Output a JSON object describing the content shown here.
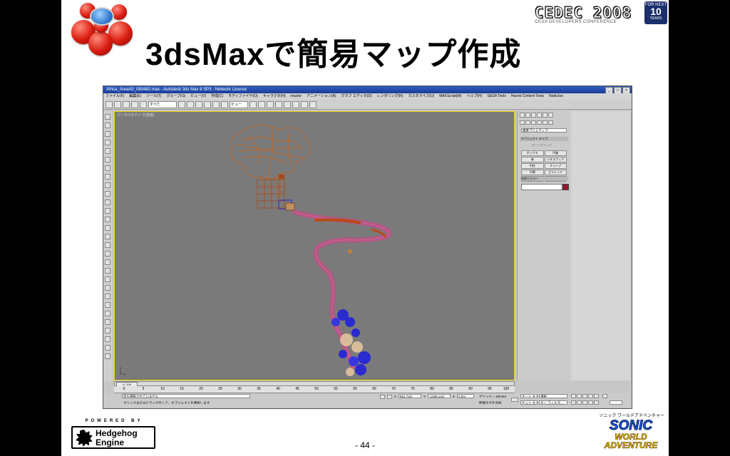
{
  "slide": {
    "title": "3dsMaxで簡易マップ作成",
    "page_number": "- 44 -"
  },
  "cedec": {
    "logo_text": "CEDEC 2008",
    "sub_text": "CESA DEVELOPERS CONFERENCE",
    "years_top": "FOR NEXT",
    "years_num": "10",
    "years_bottom": "YEARS"
  },
  "max_window": {
    "title": "Africa_AreaA0_080482.max - Autodesk 3ds Max 8 SP3 - Network License",
    "menu": [
      "ファイル(F)",
      "編集(E)",
      "ツール(T)",
      "グループ(G)",
      "ビュー(V)",
      "作成(C)",
      "モディファイヤ(O)",
      "キャラクタ(H)",
      "reactor",
      "アニメーション(A)",
      "グラフ エディタ(D)",
      "レンダリング(R)",
      "カスタマイズ(U)",
      "MAXScript(M)",
      "ヘルプ(H)",
      "SEGA Tools",
      "Havok Content Tools",
      "NodeJoe"
    ],
    "toolbar_selection": "すべて",
    "toolbar_view": "ビュー",
    "viewport_label": "パースペクティブ(透視)",
    "command_panel": {
      "category": "標準プリミティブ",
      "object_type_header": "オブジェクト タイプ",
      "autogrid": "オートグリッド",
      "buttons": [
        "ボックス",
        "円錐",
        "球",
        "ジオスフィア",
        "円柱",
        "チューブ",
        "円環",
        "ピラミッド",
        "ティーポット",
        "平面"
      ],
      "name_color_header": "名前とカラー",
      "swatch_color": "#9a1428"
    },
    "timeline": {
      "frame": "0 / 100",
      "ticks": [
        "0",
        "5",
        "10",
        "15",
        "20",
        "25",
        "30",
        "35",
        "40",
        "45",
        "50",
        "55",
        "60",
        "65",
        "70",
        "75",
        "80",
        "85",
        "90",
        "95",
        "100"
      ]
    },
    "status": {
      "line1": "何も選択されていません",
      "line2": "クリックまたはドラッグをして、オブジェクトを選択します",
      "x_label": "X",
      "x_value": "851.72m",
      "y_label": "Y",
      "y_value": "-1499.14m",
      "z_label": "Z",
      "z_value": "0.0m",
      "grid": "グリッド = 100.0m",
      "add_time_tag": "時間タグを追加",
      "autokey": "オート キー",
      "selected": "選択",
      "setkey": "セット キー",
      "keyfilter": "キー フィルタ..."
    }
  },
  "footer": {
    "powered_by": "POWERED BY",
    "engine_line1": "Hedgehog",
    "engine_line2": "Engine",
    "sonic_sub": "ソニック ワールドアドベンチャー",
    "sonic_main": "SONIC",
    "sonic_world": "WORLD",
    "sonic_adventure": "ADVENTURE"
  },
  "icons": [
    "sega-balls-logo",
    "globe-icon",
    "hedgehog-icon",
    "close-icon",
    "maximize-icon",
    "minimize-icon"
  ]
}
